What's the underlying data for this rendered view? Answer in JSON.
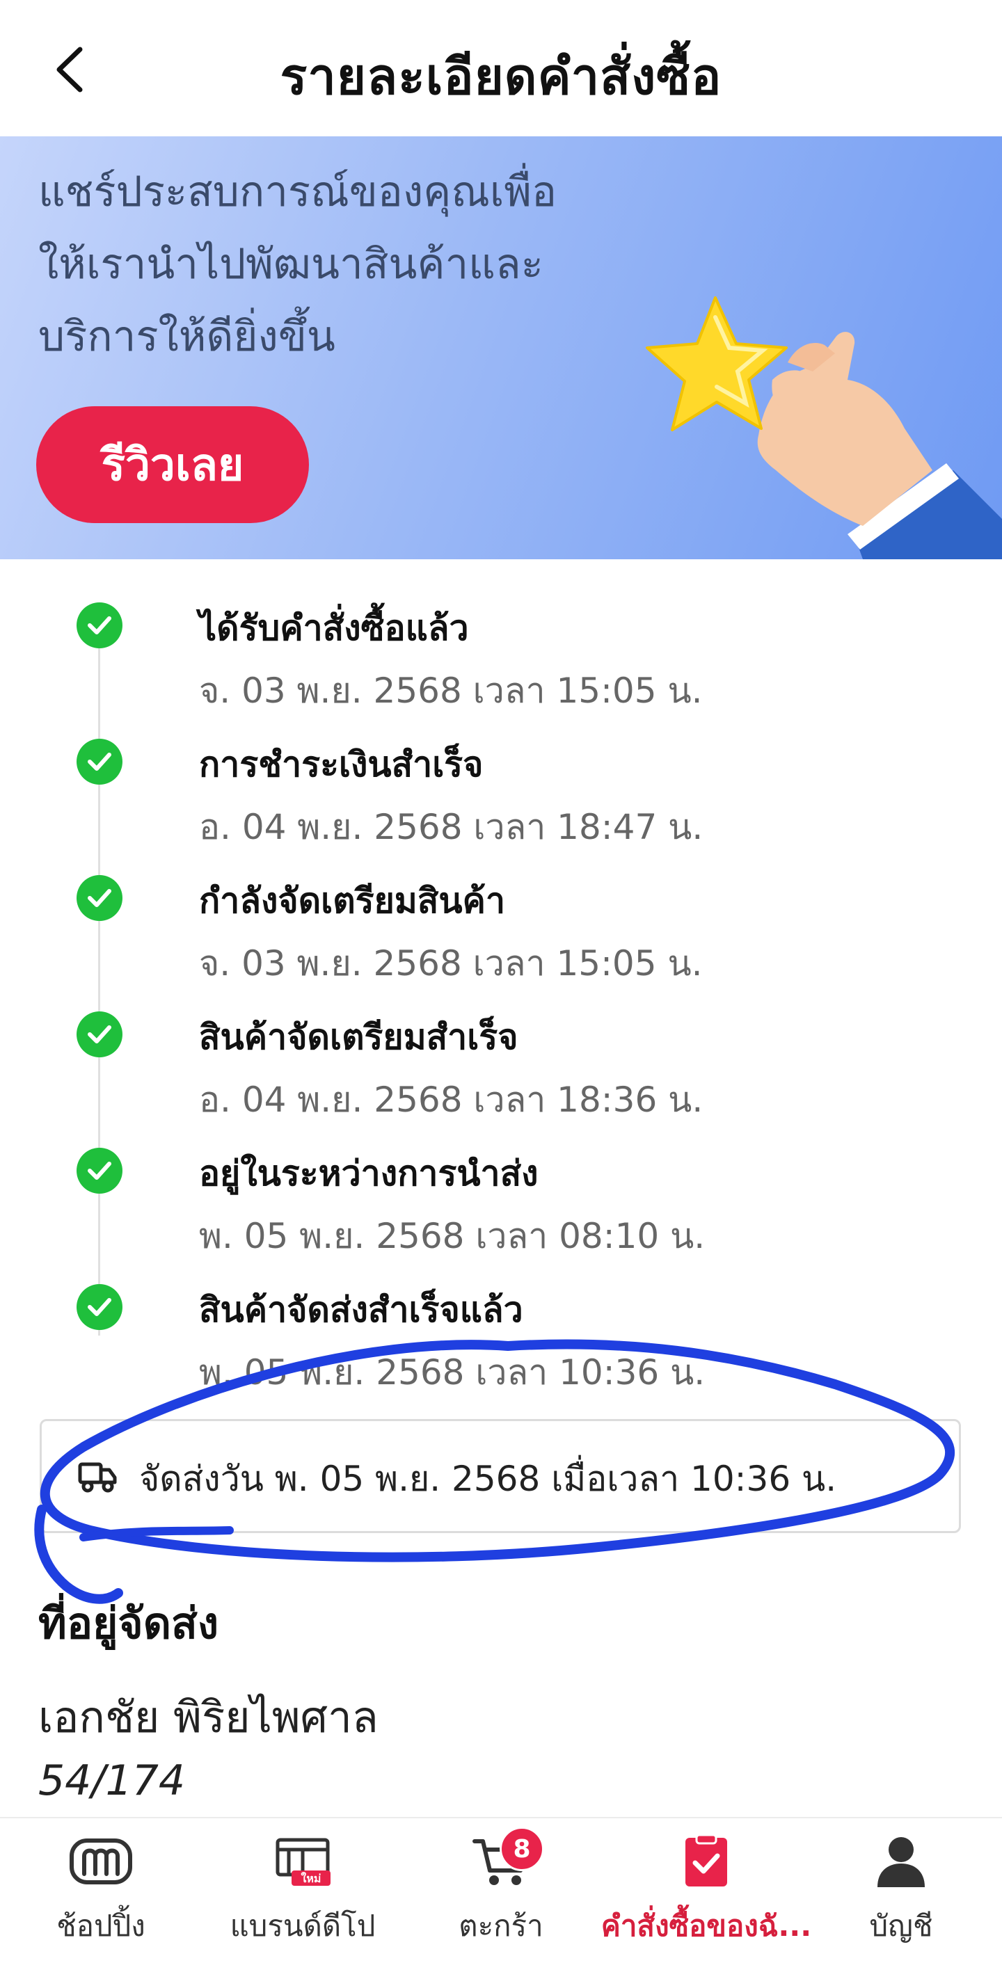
{
  "header": {
    "title": "รายละเอียดคำสั่งซื้อ"
  },
  "banner": {
    "lines": [
      "แชร์ประสบการณ์ของคุณเพื่อ",
      "ให้เรานำไปพัฒนาสินค้าและ",
      "บริการให้ดียิ่งขึ้น"
    ],
    "review_button": "รีวิวเลย"
  },
  "timeline": [
    {
      "title": "ได้รับคำสั่งซื้อแล้ว",
      "time": "จ. 03 พ.ย. 2568 เวลา 15:05 น."
    },
    {
      "title": "การชำระเงินสำเร็จ",
      "time": "อ. 04 พ.ย. 2568 เวลา 18:47 น."
    },
    {
      "title": "กำลังจัดเตรียมสินค้า",
      "time": "จ. 03 พ.ย. 2568 เวลา 15:05 น."
    },
    {
      "title": "สินค้าจัดเตรียมสำเร็จ",
      "time": "อ. 04 พ.ย. 2568 เวลา 18:36 น."
    },
    {
      "title": "อยู่ในระหว่างการนำส่ง",
      "time": "พ. 05 พ.ย. 2568 เวลา 08:10 น."
    },
    {
      "title": "สินค้าจัดส่งสำเร็จแล้ว",
      "time": "พ. 05 พ.ย. 2568 เวลา 10:36 น."
    }
  ],
  "delivery": {
    "text": "จัดส่งวัน พ. 05 พ.ย. 2568 เมื่อเวลา 10:36 น."
  },
  "address": {
    "heading": "ที่อยู่จัดส่ง",
    "name": "เอกชัย พิริยไพศาล",
    "line1": "54/174"
  },
  "nav": {
    "items": [
      {
        "label": "ช้อปปิ้ง",
        "icon": "m-logo-icon"
      },
      {
        "label": "แบรนด์ดีโป",
        "icon": "store-icon",
        "tag": "ใหม่"
      },
      {
        "label": "ตะกร้า",
        "icon": "cart-icon",
        "badge": "8"
      },
      {
        "label": "คำสั่งซื้อของฉั...",
        "icon": "orders-icon",
        "active": true
      },
      {
        "label": "บัญชี",
        "icon": "user-icon"
      }
    ]
  },
  "colors": {
    "accent": "#e8234a",
    "success": "#1fbf3c",
    "annotation": "#1f3fe0"
  }
}
